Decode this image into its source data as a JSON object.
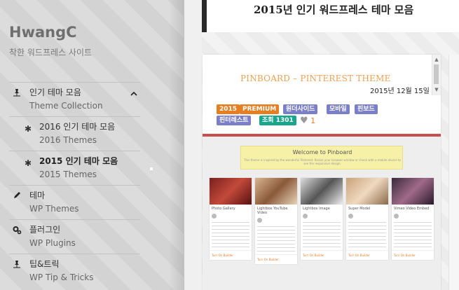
{
  "site": {
    "title": "HwangC",
    "tagline": "착한 워드프레스 사이트"
  },
  "menu": [
    {
      "label": "인기 테마 모음",
      "sub": "Theme Collection",
      "icon": "pin-icon",
      "expanded": true
    },
    {
      "label": "2016 인기 테마 모음",
      "sub": "2016 Themes",
      "icon": "asterisk-icon"
    },
    {
      "label": "2015 인기 테마 모음",
      "sub": "2015 Themes",
      "icon": "asterisk-icon",
      "active": true
    },
    {
      "label": "테마",
      "sub": "WP Themes",
      "icon": "pencil-icon"
    },
    {
      "label": "플러그인",
      "sub": "WP Plugins",
      "icon": "gears-icon"
    },
    {
      "label": "팁&트릭",
      "sub": "WP Tip & Tricks",
      "icon": "pin-icon"
    }
  ],
  "page": {
    "title": "2015년 인기 워드프레스 테마 모음"
  },
  "post": {
    "title": "PINBOARD – PINTEREST THEME",
    "date": "2015년 12월 15일",
    "tags": [
      "2015",
      "PREMIUM",
      "원더사이드",
      "모바일",
      "핀보드",
      "핀터레스트",
      "조회 1301"
    ],
    "likes": "1"
  },
  "preview": {
    "banner_title": "Welcome to Pinboard",
    "banner_sub": "This theme is inspired by the wonderful Pinterest. Resize your browser window or check with a mobile device to see the responsive design.",
    "pins": [
      {
        "title": "Photo Gallery",
        "footer": "Turn On Builder"
      },
      {
        "title": "Lightbox YouTube Video",
        "footer": "Turn On Builder"
      },
      {
        "title": "Lightbox Image",
        "footer": "Turn On Builder"
      },
      {
        "title": "Super Model",
        "footer": "Turn On Builder"
      },
      {
        "title": "Vimeo Video Embed",
        "footer": "Turn On Builder"
      }
    ]
  },
  "colors": {
    "accent_orange": "#e67e22",
    "tag_purple": "#7b7ec8",
    "tag_teal": "#1aa58d",
    "post_title": "#f2a04e"
  }
}
